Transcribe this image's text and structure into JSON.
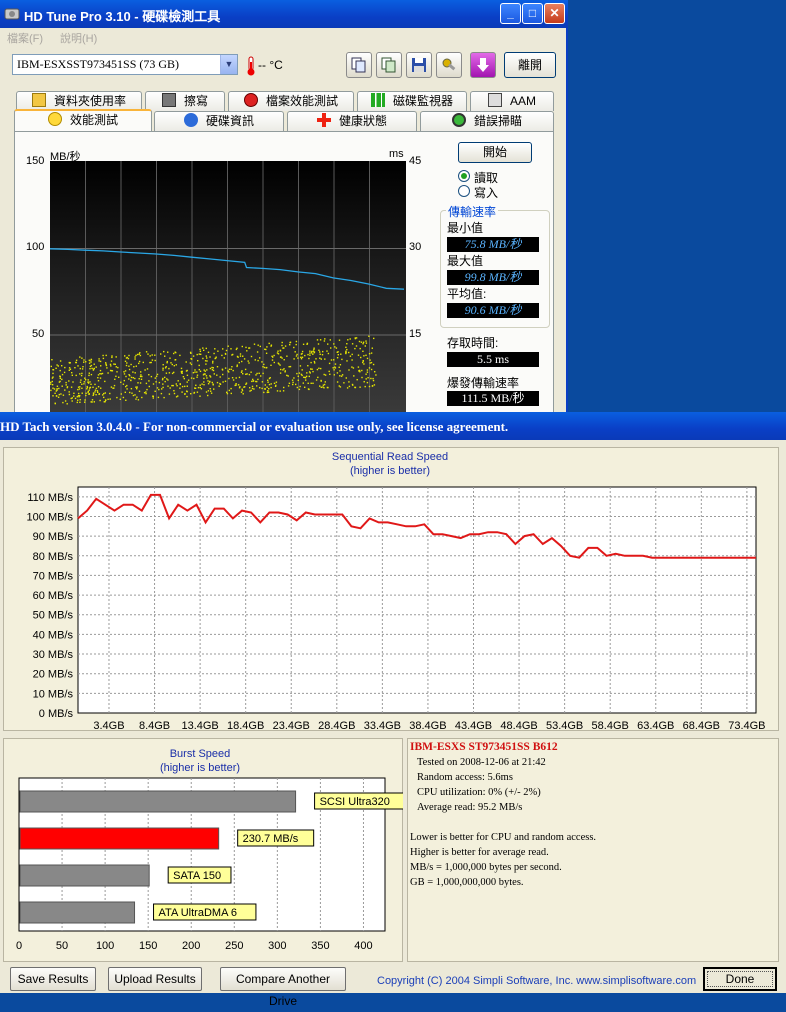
{
  "hdtune": {
    "title": "HD Tune Pro 3.10 - 硬碟檢測工具",
    "menu": [
      "檔案(F)",
      "說明(H)"
    ],
    "drive": "IBM-ESXSST973451SS (73 GB)",
    "temperature": "-- °C",
    "exit_label": "離開",
    "tabs_row1": [
      "資料夾使用率",
      "擦寫",
      "檔案效能測試",
      "磁碟監視器",
      "AAM"
    ],
    "tabs_row2": [
      "效能測試",
      "硬碟資訊",
      "健康狀態",
      "錯誤掃瞄"
    ],
    "active_tab": "效能測試",
    "start_label": "開始",
    "radio_read": "讀取",
    "radio_write": "寫入",
    "transfer_rate_label": "傳輸速率",
    "min_label": "最小值",
    "min_value": "75.8 MB/秒",
    "max_label": "最大值",
    "max_value": "99.8 MB/秒",
    "avg_label": "平均值:",
    "avg_value": "90.6 MB/秒",
    "access_label": "存取時間:",
    "access_value": "5.5 ms",
    "burst_label": "爆發傳輸速率",
    "burst_value": "111.5 MB/秒",
    "chart_data": {
      "type": "line",
      "ylabel": "MB/秒",
      "y2label": "ms",
      "y_ticks": [
        "150",
        "100",
        "50"
      ],
      "y2_ticks": [
        "45",
        "30",
        "15"
      ],
      "ylim": [
        0,
        150
      ],
      "y2lim": [
        0,
        45
      ],
      "colors": {
        "transfer": "#2aa7e6",
        "access": "#e6e600"
      },
      "series": [
        {
          "key": "transfer",
          "x": [
            0,
            5,
            10,
            15,
            20,
            25,
            30,
            35,
            40,
            45,
            50,
            55,
            55.5,
            60,
            65,
            70,
            75,
            80,
            85,
            90,
            95,
            100
          ],
          "values": [
            99.8,
            99.5,
            99,
            98.6,
            98,
            97.4,
            96.8,
            96,
            95,
            94,
            93,
            92,
            89,
            88.5,
            87.8,
            86.5,
            85.5,
            83,
            81.5,
            79.5,
            77,
            76.5
          ]
        },
        {
          "key": "access",
          "x_range": [
            0,
            92
          ],
          "y_range": [
            3,
            11
          ]
        }
      ]
    }
  },
  "hdtach": {
    "title": "HD Tach version 3.0.4.0  - For non-commercial or evaluation use only, see license agreement.",
    "seq_title": "Sequential Read Speed",
    "seq_subtitle": "(higher is better)",
    "burst_title": "Burst Speed",
    "burst_subtitle": "(higher is better)",
    "drive_name": "IBM-ESXS ST973451SS B612",
    "tested_on": "Tested on 2008-12-06 at 21:42",
    "random_access": "Random access: 5.6ms",
    "cpu_util": "CPU utilization: 0% (+/- 2%)",
    "average_read": "Average read: 95.2 MB/s",
    "note1": "Lower is better for CPU and random access.",
    "note2": "Higher is better for average read.",
    "note3": "MB/s = 1,000,000 bytes per second.",
    "note4": "GB = 1,000,000,000 bytes.",
    "save_label": "Save Results",
    "upload_label": "Upload Results",
    "compare_label": "Compare Another Drive",
    "copyright": "Copyright (C) 2004 Simpli Software, Inc. www.simplisoftware.com",
    "done_label": "Done",
    "chart_data": [
      {
        "type": "line",
        "title": "Sequential Read Speed",
        "subtitle": "(higher is better)",
        "y_ticks": [
          "0 MB/s",
          "10 MB/s",
          "20 MB/s",
          "30 MB/s",
          "40 MB/s",
          "50 MB/s",
          "60 MB/s",
          "70 MB/s",
          "80 MB/s",
          "90 MB/s",
          "100 MB/s",
          "110 MB/s"
        ],
        "x_ticks": [
          "3.4GB",
          "8.4GB",
          "13.4GB",
          "18.4GB",
          "23.4GB",
          "28.4GB",
          "33.4GB",
          "38.4GB",
          "43.4GB",
          "48.4GB",
          "53.4GB",
          "58.4GB",
          "63.4GB",
          "68.4GB",
          "73.4GB"
        ],
        "xlim": [
          0,
          74.4
        ],
        "ylim": [
          0,
          115
        ],
        "color": "#e01818",
        "x": [
          0,
          1,
          2,
          3,
          4,
          5,
          6,
          7,
          8,
          9,
          10,
          11,
          12,
          13,
          14,
          15,
          16,
          17,
          18,
          19,
          20,
          21,
          22,
          23,
          24,
          25,
          26,
          27,
          28,
          29,
          30,
          31,
          32,
          33,
          34,
          35,
          36,
          37,
          38,
          39,
          40,
          41,
          42,
          43,
          44,
          45,
          46,
          47,
          48,
          49,
          50,
          51,
          52,
          53,
          54,
          55,
          56,
          57,
          58,
          59,
          60,
          61,
          62,
          63,
          64,
          65,
          66,
          67,
          68,
          69,
          70,
          71,
          72,
          73,
          74.4
        ],
        "values": [
          99,
          103,
          109,
          106,
          103,
          106,
          106,
          103,
          111,
          111,
          99,
          106,
          103,
          106,
          97,
          104,
          104,
          99,
          103,
          102,
          97,
          102,
          102,
          101,
          98,
          102,
          101,
          101,
          101,
          101,
          95,
          94,
          99,
          97,
          97,
          96,
          95,
          95,
          96,
          91,
          91,
          90,
          89,
          91,
          91,
          92,
          92,
          91,
          86,
          90,
          91,
          86,
          89,
          85,
          80,
          79,
          84,
          84,
          80,
          81,
          80,
          80,
          80,
          79,
          79,
          79,
          79,
          79,
          79,
          79,
          79,
          79,
          79,
          79,
          79
        ]
      },
      {
        "type": "bar",
        "title": "Burst Speed",
        "subtitle": "(higher is better)",
        "orientation": "horizontal",
        "x_ticks": [
          "0",
          "50",
          "100",
          "150",
          "200",
          "250",
          "300",
          "350",
          "400"
        ],
        "xlim": [
          0,
          425
        ],
        "bars": [
          {
            "label": "SCSI Ultra320",
            "value": 320,
            "color": "#888888"
          },
          {
            "label": "230.7 MB/s",
            "value": 230.7,
            "color": "#ff0000"
          },
          {
            "label": "SATA 150",
            "value": 150,
            "color": "#888888"
          },
          {
            "label": "ATA UltraDMA 6",
            "value": 133,
            "color": "#888888"
          }
        ]
      }
    ]
  }
}
